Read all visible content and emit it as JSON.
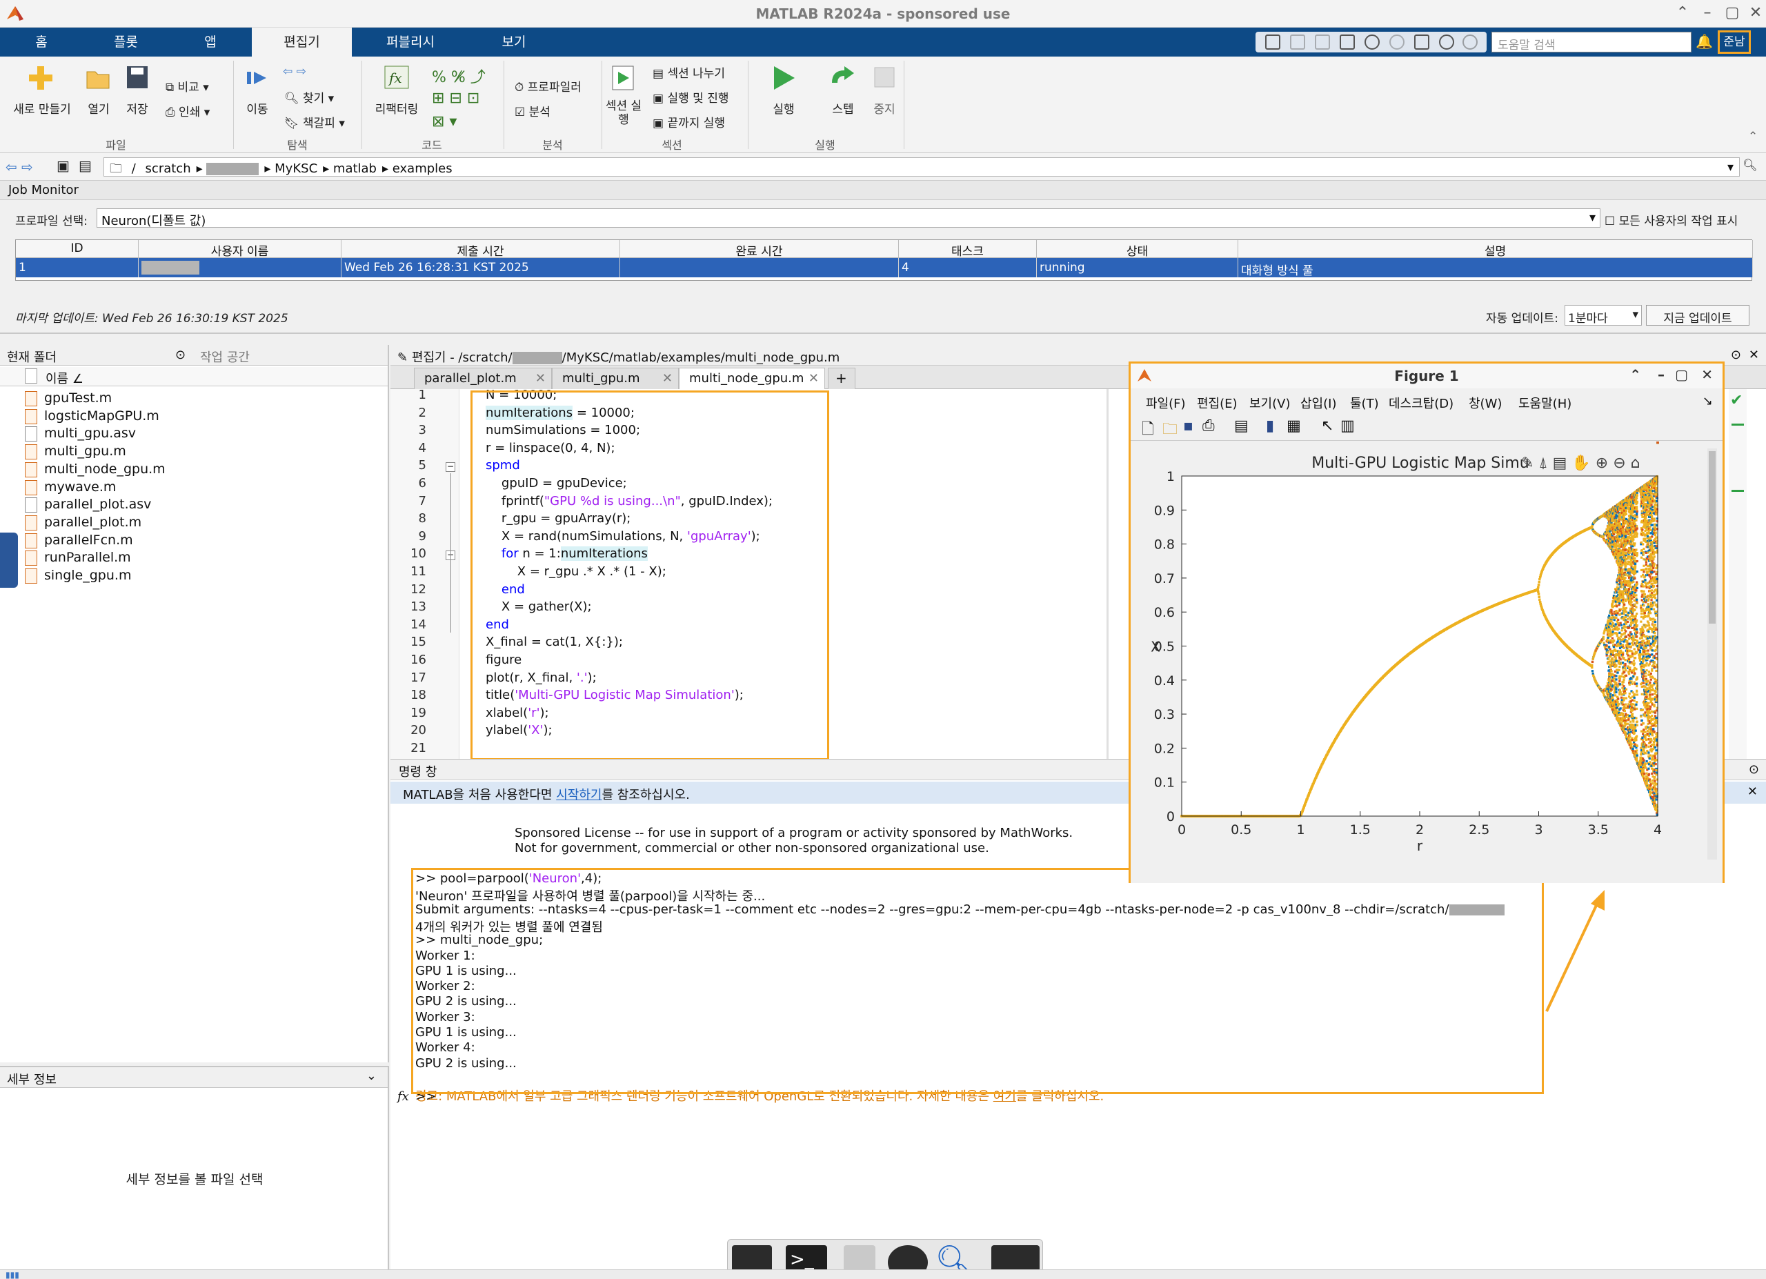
{
  "window": {
    "title": "MATLAB R2024a - sponsored use"
  },
  "ribbon_tabs": [
    "홈",
    "플롯",
    "앱",
    "편집기",
    "퍼블리시",
    "보기"
  ],
  "active_tab": "편집기",
  "help_search": {
    "placeholder": "도움말 검색"
  },
  "user_button": "준남",
  "ribbon": {
    "file": {
      "new": "새로 만들기",
      "open": "열기",
      "save": "저장",
      "compare": "비교",
      "print": "인쇄",
      "group": "파일"
    },
    "nav": {
      "goto": "이동",
      "find": "찾기",
      "bookmark": "책갈피",
      "group": "탐색"
    },
    "code": {
      "refactor": "리팩터링",
      "group": "코드"
    },
    "analyze": {
      "profiler": "프로파일러",
      "analyze": "분석",
      "group": "분석"
    },
    "section": {
      "run_section": "섹션 실행",
      "split": "섹션 나누기",
      "run_advance": "실행 및 진행",
      "run_to_end": "끝까지 실행",
      "group": "섹션"
    },
    "run": {
      "run": "실행",
      "step": "스텝",
      "stop": "중지",
      "group": "실행"
    }
  },
  "address": {
    "crumbs": [
      "/",
      "scratch",
      "",
      "MyKSC",
      "matlab",
      "examples"
    ]
  },
  "job_monitor": {
    "title": "Job Monitor",
    "profile_label": "프로파일 선택:",
    "profile_value": "Neuron(디폴트 값)",
    "show_all_label": "모든 사용자의 작업 표시",
    "columns": [
      "ID",
      "사용자 이름",
      "제출 시간",
      "완료 시간",
      "태스크",
      "상태",
      "설명"
    ],
    "rows": [
      {
        "id": "1",
        "user": "",
        "submit": "Wed Feb 26 16:28:31 KST 2025",
        "finish": "",
        "tasks": "4",
        "state": "running",
        "desc": "대화형 방식 풀"
      }
    ],
    "last_update": "마지막 업데이트: Wed Feb 26 16:30:19 KST 2025",
    "auto_update_label": "자동 업데이트:",
    "auto_update_value": "1분마다",
    "update_now": "지금 업데이트"
  },
  "current_folder": {
    "title": "현재 폴더",
    "workspace_tab": "작업 공간",
    "name_col": "이름 ∠",
    "files": [
      "gpuTest.m",
      "logsticMapGPU.m",
      "multi_gpu.asv",
      "multi_gpu.m",
      "multi_node_gpu.m",
      "mywave.m",
      "parallel_plot.asv",
      "parallel_plot.m",
      "parallelFcn.m",
      "runParallel.m",
      "single_gpu.m"
    ]
  },
  "details": {
    "title": "세부 정보",
    "placeholder": "세부 정보를 볼 파일 선택"
  },
  "editor": {
    "header": "편집기 - /scratch/",
    "header_tail": "/MyKSC/matlab/examples/multi_node_gpu.m",
    "tabs": [
      "parallel_plot.m",
      "multi_gpu.m",
      "multi_node_gpu.m"
    ],
    "active_tab": "multi_node_gpu.m",
    "line_numbers": [
      "1",
      "2",
      "3",
      "4",
      "5",
      "6",
      "7",
      "8",
      "9",
      "10",
      "11",
      "12",
      "13",
      "14",
      "15",
      "16",
      "17",
      "18",
      "19",
      "20",
      "21"
    ],
    "code": [
      "N = 10000;",
      "numIterations = 10000;",
      "numSimulations = 1000;",
      "r = linspace(0, 4, N);",
      "spmd",
      "    gpuID = gpuDevice;",
      "    fprintf(\"GPU %d is using...\\n\", gpuID.Index);",
      "    r_gpu = gpuArray(r);",
      "    X = rand(numSimulations, N, 'gpuArray');",
      "    for n = 1:numIterations",
      "        X = r_gpu .* X .* (1 - X);",
      "    end",
      "    X = gather(X);",
      "end",
      "X_final = cat(1, X{:});",
      "figure",
      "plot(r, X_final, '.');",
      "title('Multi-GPU Logistic Map Simulation');",
      "xlabel('r');",
      "ylabel('X');"
    ]
  },
  "command_window": {
    "title": "명령 창",
    "banner_pre": "MATLAB을 처음 사용한다면 ",
    "banner_link": "시작하기",
    "banner_post": "를 참조하십시오.",
    "license_1": "Sponsored License -- for use in support of a program or activity sponsored by MathWorks.",
    "license_2": "Not for government, commercial or other non-sponsored organizational use.",
    "lines": [
      ">> pool=parpool('Neuron',4);",
      "'Neuron' 프로파일을 사용하여 병렬 풀(parpool)을 시작하는 중...",
      "Submit arguments: --ntasks=4 --cpus-per-task=1 --comment etc --nodes=2 --gres=gpu:2 --mem-per-cpu=4gb --ntasks-per-node=2 -p cas_v100nv_8 --chdir=/scratch/",
      "4개의 워커가 있는 병렬 풀에 연결됨",
      ">> multi_node_gpu;",
      "Worker 1:",
      "  GPU 1 is using...",
      "Worker 2:",
      "  GPU 2 is using...",
      "Worker 3:",
      "  GPU 1 is using...",
      "Worker 4:",
      "  GPU 2 is using..."
    ],
    "warning_pre": "경고: MATLAB에서 일부 고급 그래픽스 렌더링 기능이 소프트웨어 OpenGL로 전환되었습니다. 자세한 내용은 ",
    "warning_link": "여기",
    "warning_post": "를 클릭하십시오.",
    "prompt": ">>"
  },
  "figure": {
    "title": "Figure 1",
    "menu": [
      "파일(F)",
      "편집(E)",
      "보기(V)",
      "삽입(I)",
      "툴(T)",
      "데스크탑(D)",
      "창(W)",
      "도움말(H)"
    ]
  },
  "chart_data": {
    "type": "scatter",
    "title": "Multi-GPU Logistic Map Simu",
    "xlabel": "r",
    "ylabel": "X",
    "xlim": [
      0,
      4
    ],
    "ylim": [
      0,
      1
    ],
    "xticks": [
      0,
      0.5,
      1,
      1.5,
      2,
      2.5,
      3,
      3.5,
      4
    ],
    "yticks": [
      0,
      0.1,
      0.2,
      0.3,
      0.4,
      0.5,
      0.6,
      0.7,
      0.8,
      0.9,
      1
    ],
    "x_tick_labels": [
      "0",
      "0.5",
      "1",
      "1.5",
      "2",
      "2.5",
      "3",
      "3.5",
      "4"
    ],
    "y_tick_labels": [
      "0",
      "0.1",
      "0.2",
      "0.3",
      "0.4",
      "0.5",
      "0.6",
      "0.7",
      "0.8",
      "0.9",
      "1"
    ],
    "series_colors": [
      "#edb120",
      "#d95319",
      "#0072bd"
    ],
    "grid": false
  },
  "colors": {
    "accent_highlight": "#f5a623",
    "ribbon_blue": "#0d4a86",
    "selection_blue": "#2c63b8"
  }
}
